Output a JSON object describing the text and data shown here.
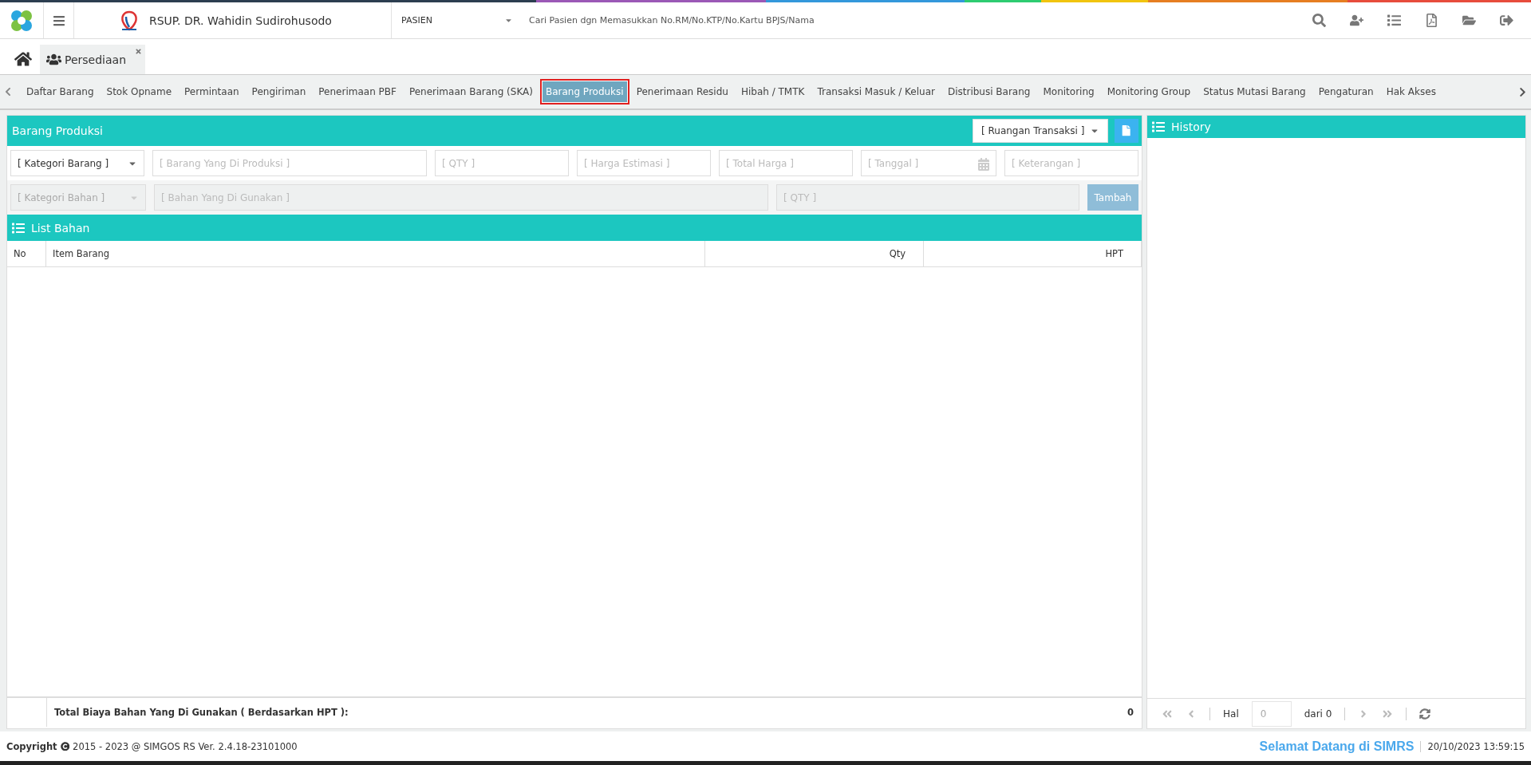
{
  "header": {
    "hospital_name": "RSUP. DR. Wahidin Sudirohusodo",
    "patient_type": "PASIEN",
    "search": {
      "placeholder": "Cari Pasien dgn Memasukkan No.RM/No.KTP/No.Kartu BPJS/Nama"
    }
  },
  "open_tabs": [
    {
      "label": "Persediaan",
      "selected": true
    }
  ],
  "menu": [
    {
      "label": "Daftar Barang",
      "selected": false
    },
    {
      "label": "Stok Opname",
      "selected": false
    },
    {
      "label": "Permintaan",
      "selected": false
    },
    {
      "label": "Pengiriman",
      "selected": false
    },
    {
      "label": "Penerimaan PBF",
      "selected": false
    },
    {
      "label": "Penerimaan Barang (SKA)",
      "selected": false
    },
    {
      "label": "Barang Produksi",
      "selected": true
    },
    {
      "label": "Penerimaan Residu",
      "selected": false
    },
    {
      "label": "Hibah / TMTK",
      "selected": false
    },
    {
      "label": "Transaksi Masuk / Keluar",
      "selected": false
    },
    {
      "label": "Distribusi Barang",
      "selected": false
    },
    {
      "label": "Monitoring",
      "selected": false
    },
    {
      "label": "Monitoring Group",
      "selected": false
    },
    {
      "label": "Status Mutasi Barang",
      "selected": false
    },
    {
      "label": "Pengaturan",
      "selected": false
    },
    {
      "label": "Hak Akses",
      "selected": false
    }
  ],
  "production_panel": {
    "title": "Barang Produksi",
    "room_select": "[ Ruangan Transaksi ]",
    "product_fields": [
      {
        "kind": "select",
        "value": "[ Kategori Barang ]",
        "disabled": false
      },
      {
        "kind": "text",
        "placeholder": "[ Barang Yang Di Produksi ]",
        "disabled": false
      },
      {
        "kind": "text",
        "placeholder": "[ QTY ]",
        "disabled": false
      },
      {
        "kind": "text",
        "placeholder": "[ Harga Estimasi ]",
        "disabled": false
      },
      {
        "kind": "text",
        "placeholder": "[ Total Harga ]",
        "disabled": false
      },
      {
        "kind": "date",
        "placeholder": "[ Tanggal ]",
        "disabled": false
      },
      {
        "kind": "text",
        "placeholder": "[ Keterangan ]",
        "disabled": false
      }
    ],
    "material_fields": [
      {
        "kind": "select",
        "value": "[ Kategori Bahan ]",
        "disabled": true
      },
      {
        "kind": "text",
        "placeholder": "[ Bahan Yang Di Gunakan ]",
        "disabled": true
      },
      {
        "kind": "text",
        "placeholder": "[ QTY ]",
        "disabled": true
      }
    ],
    "add_button": {
      "label": "Tambah",
      "disabled": true
    }
  },
  "material_list": {
    "title": "List Bahan",
    "columns": [
      "No",
      "Item Barang",
      "Qty",
      "HPT"
    ],
    "total_label": "Total Biaya Bahan Yang Di Gunakan ( Berdasarkan HPT ):",
    "total_value": "0"
  },
  "history": {
    "title": "History",
    "pager": {
      "page_label": "Hal",
      "page_value": "0",
      "of_label": "dari 0"
    }
  },
  "footer": {
    "copyright_label": "Copyright",
    "copyright_text": "2015 - 2023 @ SIMGOS RS Ver. 2.4.18-23101000",
    "welcome": "Selamat Datang di SIMRS",
    "datetime": "20/10/2023 13:59:15"
  }
}
